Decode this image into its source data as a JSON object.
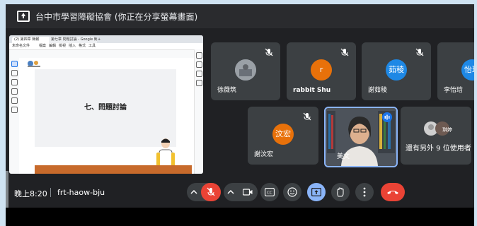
{
  "header": {
    "title": "台中市學習障礙協會 (你正在分享螢幕畫面)",
    "icon": "present-to-all-icon"
  },
  "shared_screen": {
    "browser_tabs": [
      "(2) 第四章 簡報",
      "第七章 問題討論 - Google 簡",
      "+"
    ],
    "menu_items": [
      "未命名文件",
      "檔案",
      "編輯",
      "檢視",
      "插入",
      "格式",
      "工具"
    ],
    "slide_title": "七、問題討論"
  },
  "participants": [
    {
      "name": "徐薇筑",
      "avatar": "photo",
      "muted": true
    },
    {
      "name": "rabbit Shu",
      "avatar": "r",
      "avatar_color": "#e8710a",
      "muted": true
    },
    {
      "name": "謝茹稜",
      "avatar": "茹稜",
      "avatar_color": "#1e88e5",
      "muted": true
    },
    {
      "name": "李怡琀",
      "avatar": "怡琀",
      "avatar_color": "#1e88e5",
      "muted": false
    },
    {
      "name": "謝汶宏",
      "avatar": "汶宏",
      "avatar_color": "#e8710a",
      "muted": true
    },
    {
      "name": "美文",
      "avatar": "video",
      "muted": false,
      "speaking": true
    }
  ],
  "more_users": {
    "text": "還有另外 9 位使用者",
    "avatar_label": "琪婷"
  },
  "bottom_bar": {
    "time": "晚上8:20",
    "meeting_code": "frt-haow-bju"
  },
  "colors": {
    "red": "#ea4335",
    "blue": "#8ab4f8",
    "tile": "#3c4043",
    "background": "#202124"
  }
}
